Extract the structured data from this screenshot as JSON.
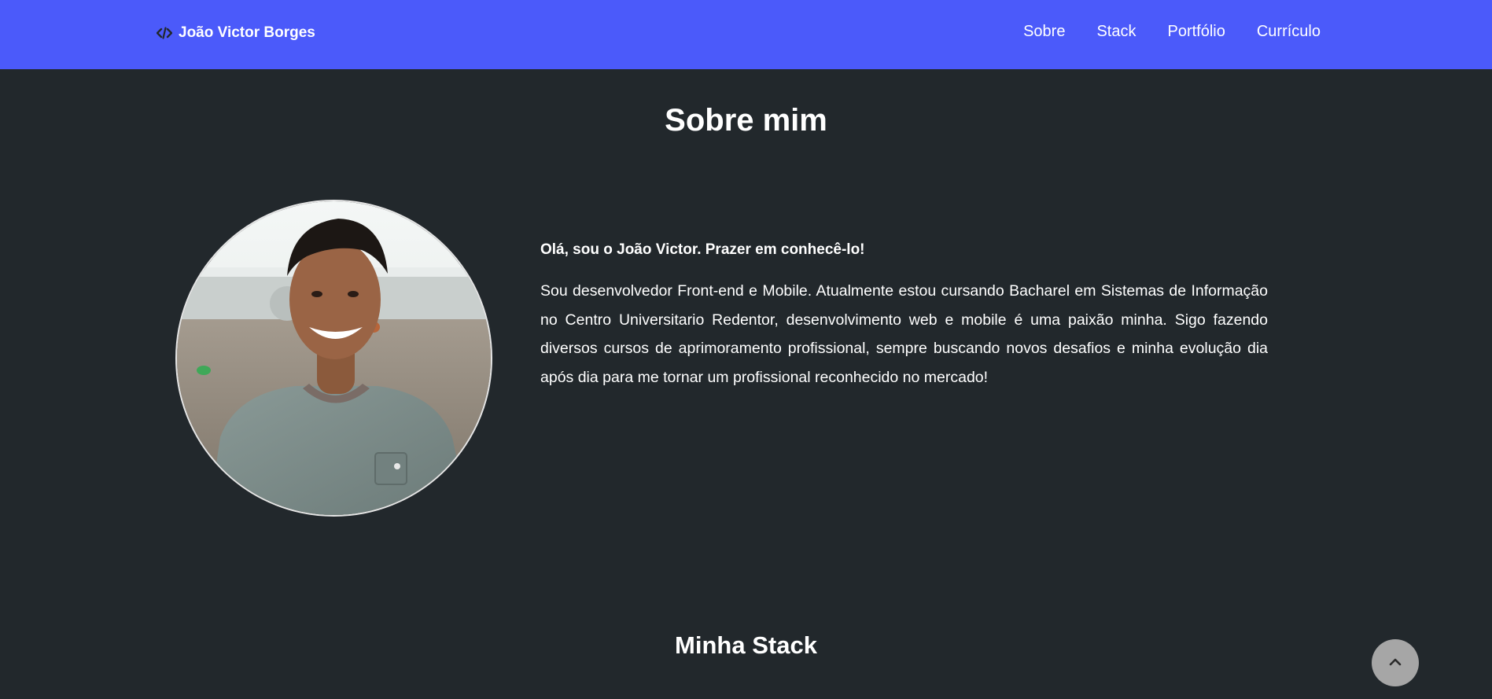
{
  "navbar": {
    "brand": {
      "icon": "code-icon",
      "label": "João Victor Borges"
    },
    "links": [
      {
        "label": "Sobre"
      },
      {
        "label": "Stack"
      },
      {
        "label": "Portfólio"
      },
      {
        "label": "Currículo"
      }
    ],
    "background_color": "#4b5afa"
  },
  "about": {
    "title": "Sobre mim",
    "greeting": "Olá, sou o João Victor. Prazer em conhecê-lo!",
    "body": "Sou desenvolvedor Front-end e Mobile. Atualmente estou cursando Bacharel em Sistemas de Informação no Centro Universitario Redentor, desenvolvimento web e mobile é uma paixão minha. Sigo fazendo diversos cursos de aprimoramento profissional, sempre buscando novos desafios e minha evolução dia após dia para me tornar um profissional reconhecido no mercado!"
  },
  "stack": {
    "title": "Minha Stack"
  },
  "back_to_top": {
    "icon": "chevron-up-icon"
  },
  "colors": {
    "page_background": "#22282c",
    "text": "#ffffff",
    "back_to_top_button": "#a6a6a6"
  }
}
